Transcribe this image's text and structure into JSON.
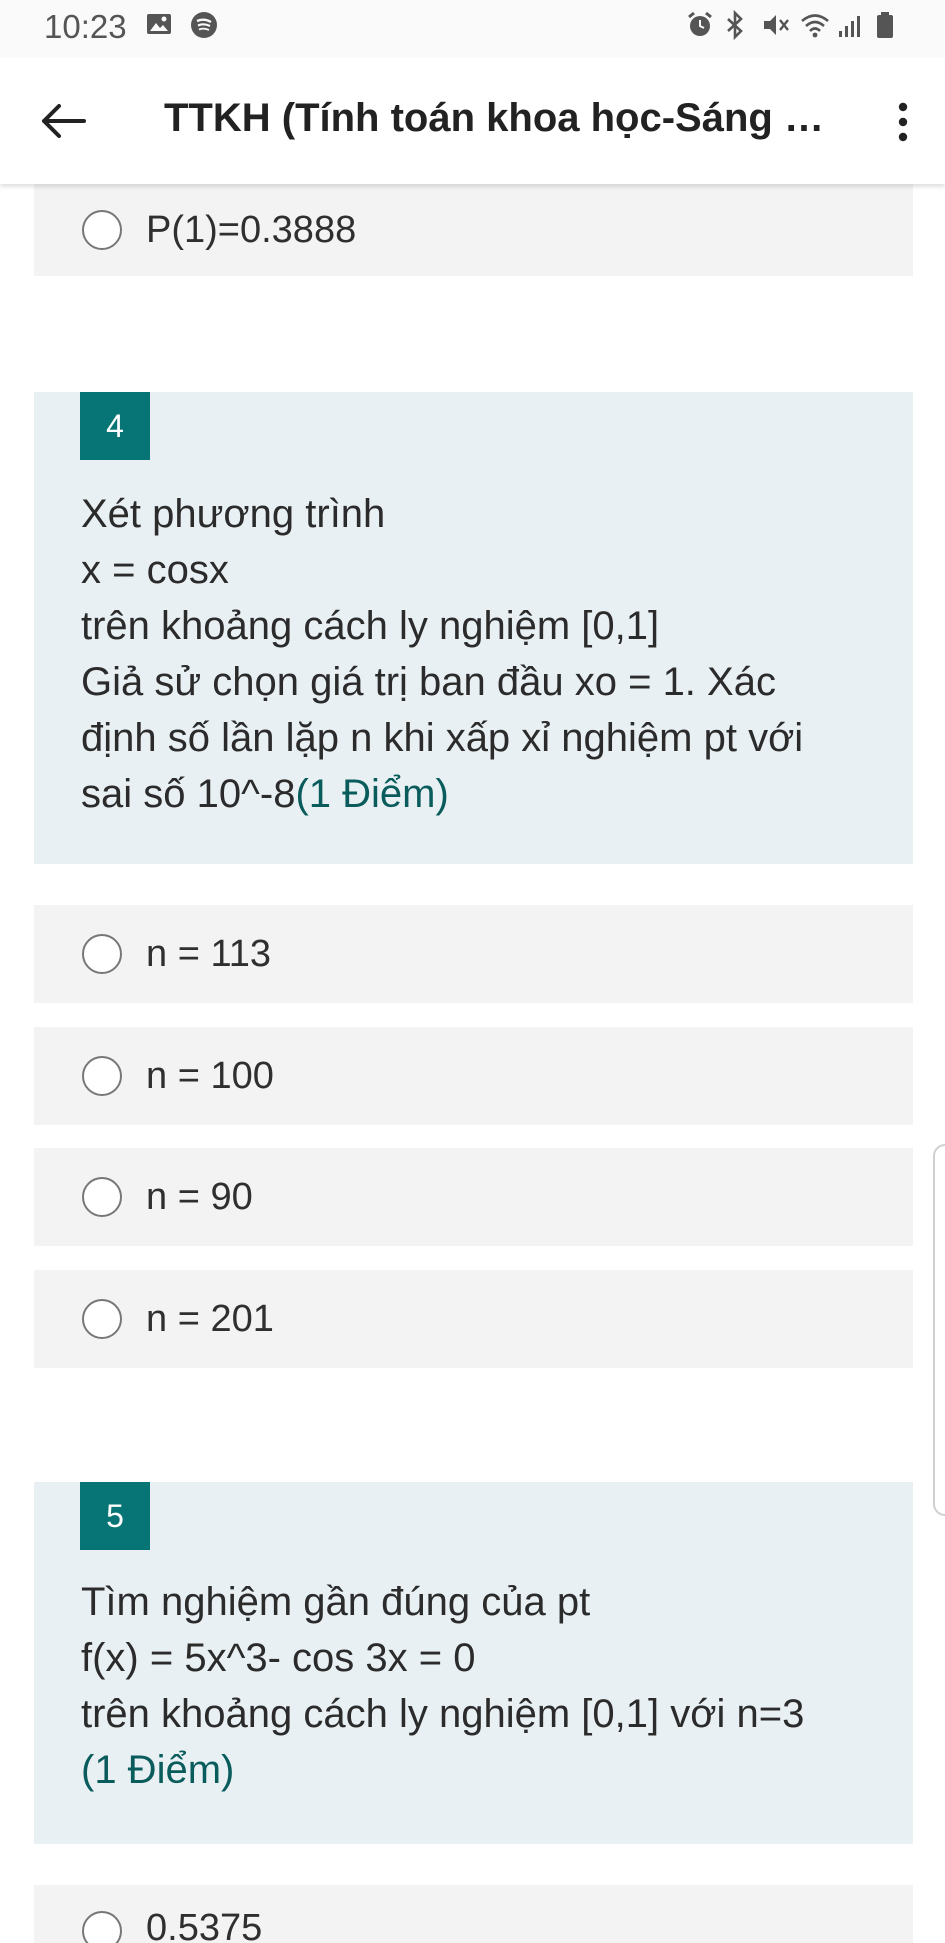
{
  "status_bar": {
    "time": "10:23"
  },
  "app_bar": {
    "title": "TTKH (Tính toán khoa học-Sáng th..."
  },
  "prev_option": {
    "label": "P(1)=0.3888"
  },
  "question4": {
    "number": "4",
    "lines": [
      "Xét phương trình",
      "x = cosx",
      "trên khoảng cách ly nghiệm [0,1]",
      "Giả sử chọn giá trị ban đầu xo = 1. Xác",
      "định số lần lặp n khi xấp xỉ nghiệm pt với",
      "sai số 10^-8"
    ],
    "points": "(1 Điểm)",
    "options": [
      "n = 113",
      "n = 100",
      "n = 90",
      "n = 201"
    ]
  },
  "question5": {
    "number": "5",
    "lines": [
      "Tìm nghiệm gần đúng của pt",
      "f(x) = 5x^3- cos 3x = 0",
      "trên khoảng cách ly nghiệm [0,1] với n=3"
    ],
    "points": "(1 Điểm)",
    "options": [
      "0.5375"
    ]
  },
  "colors": {
    "accent": "#077475",
    "question_bg": "#e8f0f3",
    "option_bg": "#f3f3f3",
    "points_text": "#0a5c5c"
  }
}
